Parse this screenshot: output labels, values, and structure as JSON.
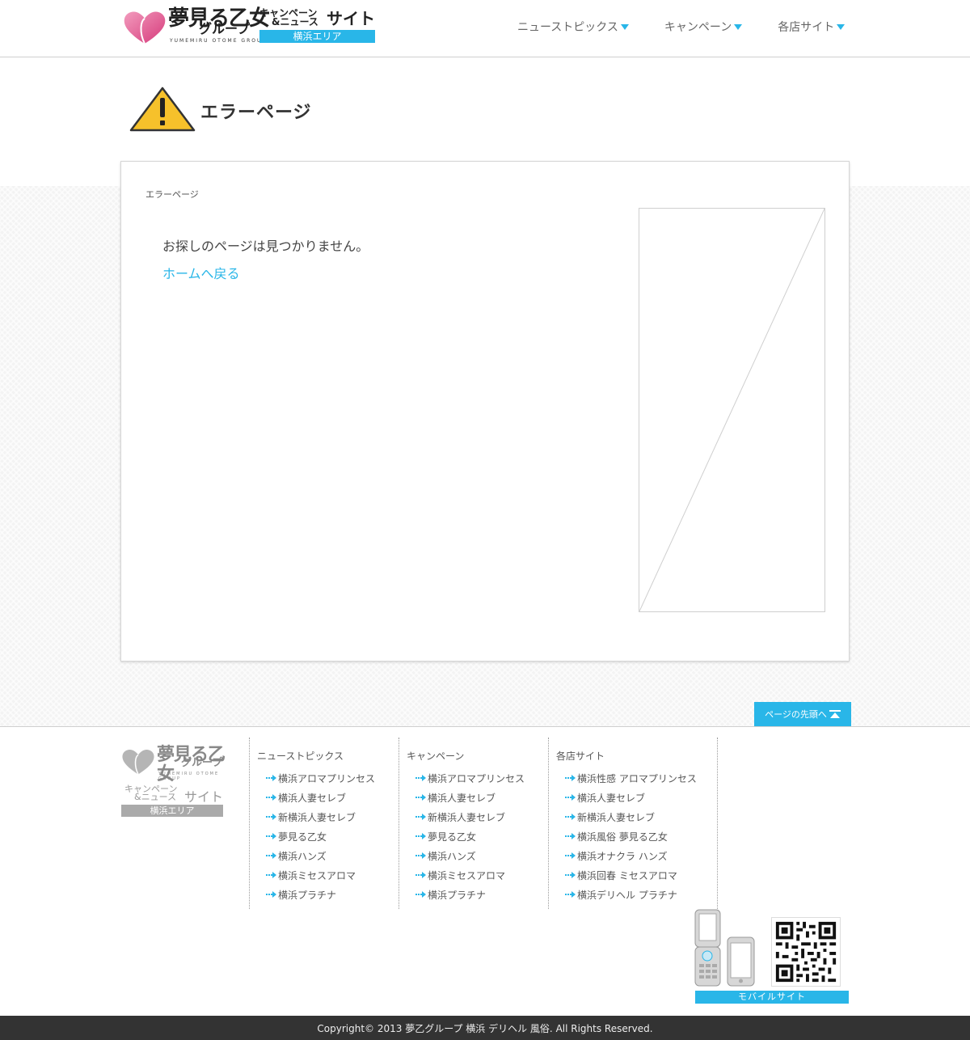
{
  "header": {
    "logo": {
      "name_line1": "夢見る乙女",
      "name_line2": "グループ",
      "romaji": "YUMEMIRU OTOME GROUP",
      "sub_line1": "キャンペーン",
      "sub_line2": "&ニュース",
      "sub_site": "サイト",
      "area": "横浜エリア"
    },
    "nav": [
      {
        "label": "ニューストピックス",
        "icon": "triangle-down-icon"
      },
      {
        "label": "キャンペーン",
        "icon": "triangle-down-icon"
      },
      {
        "label": "各店サイト",
        "icon": "triangle-down-icon"
      }
    ]
  },
  "page": {
    "title": "エラーページ",
    "title_icon": "warning-icon"
  },
  "content": {
    "breadcrumb": "エラーページ",
    "message": "お探しのページは見つかりません。",
    "home_link": "ホームへ戻る"
  },
  "to_top": {
    "label": "ページの先頭へ",
    "icon": "arrow-up-to-top-icon"
  },
  "footer": {
    "logo": {
      "name_line1": "夢見る乙女",
      "name_line2": "グループ",
      "romaji": "YUMEMIRU OTOME GROUP",
      "sub_line1": "キャンペーン",
      "sub_line2": "&ニュース",
      "sub_site": "サイト",
      "area": "横浜エリア"
    },
    "columns": [
      {
        "heading": "ニューストピックス",
        "items": [
          "横浜アロマプリンセス",
          "横浜人妻セレブ",
          "新横浜人妻セレブ",
          "夢見る乙女",
          "横浜ハンズ",
          "横浜ミセスアロマ",
          "横浜プラチナ"
        ]
      },
      {
        "heading": "キャンペーン",
        "items": [
          "横浜アロマプリンセス",
          "横浜人妻セレブ",
          "新横浜人妻セレブ",
          "夢見る乙女",
          "横浜ハンズ",
          "横浜ミセスアロマ",
          "横浜プラチナ"
        ]
      },
      {
        "heading": "各店サイト",
        "items": [
          "横浜性感 アロマプリンセス",
          "横浜人妻セレブ",
          "新横浜人妻セレブ",
          "横浜風俗 夢見る乙女",
          "横浜オナクラ ハンズ",
          "横浜回春 ミセスアロマ",
          "横浜デリヘル プラチナ"
        ]
      }
    ],
    "mobile_label": "モバイルサイト",
    "copyright": "Copyright© 2013 夢乙グループ 横浜 デリヘル 風俗. All Rights Reserved."
  },
  "colors": {
    "accent": "#29b6e8",
    "heart_pink": "#e0578f",
    "warning_yellow": "#f6c12b",
    "footer_bar": "#333333"
  }
}
